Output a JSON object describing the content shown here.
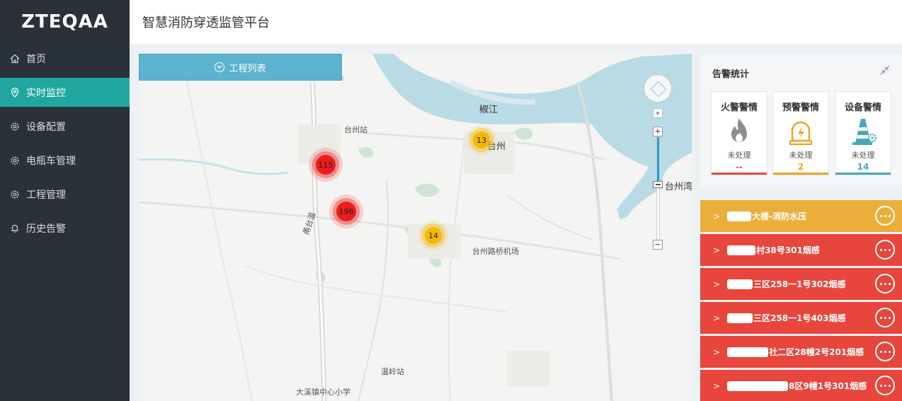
{
  "app": {
    "logo": "ZTEQAA",
    "title": "智慧消防穿透监管平台"
  },
  "sidebar": {
    "items": [
      {
        "label": "首页",
        "icon": "home-icon",
        "active": false
      },
      {
        "label": "实时监控",
        "icon": "location-pin-icon",
        "active": true
      },
      {
        "label": "设备配置",
        "icon": "gear-icon",
        "active": false
      },
      {
        "label": "电瓶车管理",
        "icon": "gear-icon",
        "active": false
      },
      {
        "label": "工程管理",
        "icon": "gear-icon",
        "active": false
      },
      {
        "label": "历史告警",
        "icon": "bell-icon",
        "active": false
      }
    ]
  },
  "map": {
    "project_list_label": "工程列表",
    "labels": {
      "jiaojiang": "椒江",
      "taizhou_station": "台州站",
      "taizhou": "台州",
      "taizhou_bay": "台州湾",
      "airport": "台州路桥机场",
      "wenling_station": "温岭站",
      "school": "大溪镇中心小学",
      "road": "甬台温"
    },
    "clusters": [
      {
        "count": "115",
        "level": "fire"
      },
      {
        "count": "196",
        "level": "fire"
      },
      {
        "count": "13",
        "level": "warning"
      },
      {
        "count": "14",
        "level": "warning"
      }
    ],
    "zoom_level": 0.55,
    "zoom_in": "+",
    "zoom_out": "−"
  },
  "stats": {
    "title": "告警统计",
    "cards": [
      {
        "title": "火警警情",
        "status": "未处理",
        "count": "--",
        "color": "#e84a3f",
        "icon": "flame-icon"
      },
      {
        "title": "预警警情",
        "status": "未处理",
        "count": "2",
        "color": "#f0a21f",
        "icon": "alarm-lamp-icon"
      },
      {
        "title": "设备警情",
        "status": "未处理",
        "count": "14",
        "color": "#4aa7b9",
        "icon": "traffic-cone-gear-icon"
      }
    ]
  },
  "alarms": [
    {
      "text": "大楼-消防水压",
      "level": "warning"
    },
    {
      "text": "村38号301烟感",
      "level": "fire"
    },
    {
      "text": "三区258一1号302烟感",
      "level": "fire"
    },
    {
      "text": "三区258一1号403烟感",
      "level": "fire"
    },
    {
      "text": "社二区28幢2号201烟感",
      "level": "fire"
    },
    {
      "text": "8区9幢1号301烟感",
      "level": "fire"
    }
  ],
  "colors": {
    "sidebar_bg": "#2b3138",
    "active": "#1fa69e",
    "fire": "#e8453c",
    "warning": "#eaaf3a",
    "device": "#4aa7b9",
    "water": "#b9dbe6"
  }
}
